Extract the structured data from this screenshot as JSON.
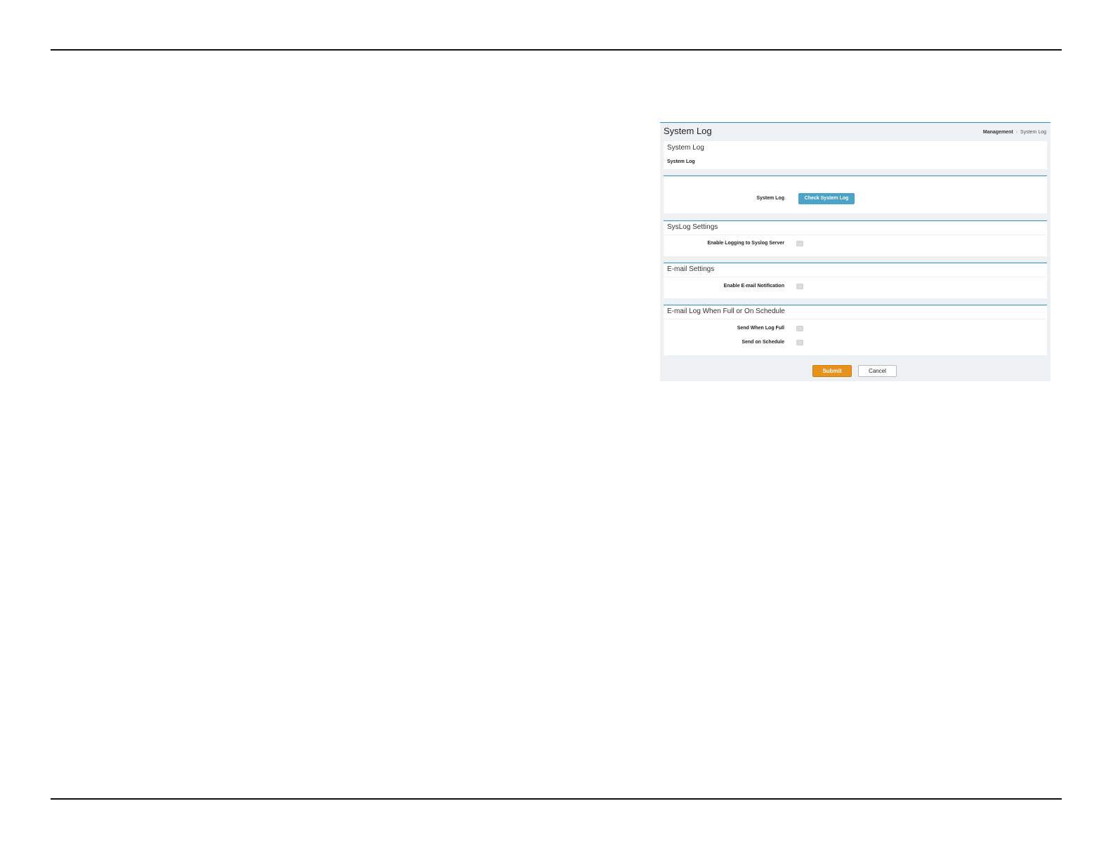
{
  "page": {
    "title": "System Log",
    "breadcrumb": {
      "parent": "Management",
      "separator": "›",
      "current": "System Log"
    }
  },
  "intro_panel": {
    "title": "System Log",
    "subtitle": "System Log"
  },
  "system_log_panel": {
    "label": "System Log",
    "button": "Check System Log"
  },
  "syslog_panel": {
    "title": "SysLog Settings",
    "row_label": "Enable Logging to Syslog Server",
    "checked": false
  },
  "email_panel": {
    "title": "E-mail Settings",
    "row_label": "Enable E-mail Notification",
    "checked": false
  },
  "schedule_panel": {
    "title": "E-mail Log When Full or On Schedule",
    "rows": [
      {
        "label": "Send When Log Full",
        "checked": false
      },
      {
        "label": "Send on Schedule",
        "checked": false
      }
    ]
  },
  "actions": {
    "submit": "Submit",
    "cancel": "Cancel"
  },
  "colors": {
    "accent_blue": "#2b8fd0",
    "button_blue": "#4aa3c8",
    "submit_orange": "#e8921e",
    "panel_bg": "#eef1f4"
  }
}
